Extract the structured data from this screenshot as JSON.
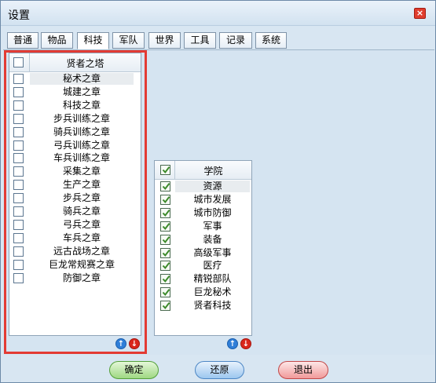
{
  "window": {
    "title": "设置",
    "close_label": "×"
  },
  "tabs": [
    {
      "label": "普通",
      "active": false
    },
    {
      "label": "物品",
      "active": false
    },
    {
      "label": "科技",
      "active": true
    },
    {
      "label": "军队",
      "active": false
    },
    {
      "label": "世界",
      "active": false
    },
    {
      "label": "工具",
      "active": false
    },
    {
      "label": "记录",
      "active": false
    },
    {
      "label": "系统",
      "active": false
    }
  ],
  "left_list": {
    "header": "贤者之塔",
    "header_checked": false,
    "items": [
      {
        "label": "秘术之章",
        "checked": false,
        "selected": true
      },
      {
        "label": "城建之章",
        "checked": false,
        "selected": false
      },
      {
        "label": "科技之章",
        "checked": false,
        "selected": false
      },
      {
        "label": "步兵训练之章",
        "checked": false,
        "selected": false
      },
      {
        "label": "骑兵训练之章",
        "checked": false,
        "selected": false
      },
      {
        "label": "弓兵训练之章",
        "checked": false,
        "selected": false
      },
      {
        "label": "车兵训练之章",
        "checked": false,
        "selected": false
      },
      {
        "label": "采集之章",
        "checked": false,
        "selected": false
      },
      {
        "label": "生产之章",
        "checked": false,
        "selected": false
      },
      {
        "label": "步兵之章",
        "checked": false,
        "selected": false
      },
      {
        "label": "骑兵之章",
        "checked": false,
        "selected": false
      },
      {
        "label": "弓兵之章",
        "checked": false,
        "selected": false
      },
      {
        "label": "车兵之章",
        "checked": false,
        "selected": false
      },
      {
        "label": "远古战场之章",
        "checked": false,
        "selected": false
      },
      {
        "label": "巨龙常规赛之章",
        "checked": false,
        "selected": false
      },
      {
        "label": "防御之章",
        "checked": false,
        "selected": false
      }
    ]
  },
  "right_list": {
    "header": "学院",
    "header_checked": true,
    "items": [
      {
        "label": "资源",
        "checked": true,
        "selected": true
      },
      {
        "label": "城市发展",
        "checked": true,
        "selected": false
      },
      {
        "label": "城市防御",
        "checked": true,
        "selected": false
      },
      {
        "label": "军事",
        "checked": true,
        "selected": false
      },
      {
        "label": "装备",
        "checked": true,
        "selected": false
      },
      {
        "label": "高级军事",
        "checked": true,
        "selected": false
      },
      {
        "label": "医疗",
        "checked": true,
        "selected": false
      },
      {
        "label": "精锐部队",
        "checked": true,
        "selected": false
      },
      {
        "label": "巨龙秘术",
        "checked": true,
        "selected": false
      },
      {
        "label": "贤者科技",
        "checked": true,
        "selected": false
      }
    ]
  },
  "arrows": {
    "up": "↑",
    "down": "↓"
  },
  "buttons": {
    "ok": "确定",
    "reset": "还原",
    "exit": "退出"
  },
  "colors": {
    "highlight": "#e33b34",
    "check": "#3c8a2a"
  }
}
